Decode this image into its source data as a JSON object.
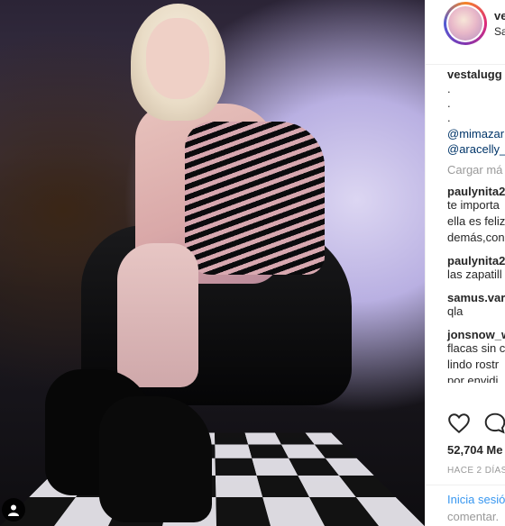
{
  "post": {
    "username": "vestalugg",
    "username_short": "ve",
    "location_short": "Sa"
  },
  "caption": {
    "username": "vestalugg",
    "lines": [
      ".",
      ".",
      "."
    ],
    "mentions": [
      "@mimazar",
      "@aracelly_"
    ]
  },
  "load_more": "Cargar má",
  "comments": [
    {
      "user": "paulynita2",
      "lines": [
        "te importa",
        "ella es feliz",
        "demás,con"
      ]
    },
    {
      "user": "paulynita2",
      "lines": [
        "las zapatill"
      ]
    },
    {
      "user": "samus.vara",
      "lines": [
        "qla"
      ]
    },
    {
      "user": "jonsnow_w",
      "lines": [
        "flacas sin c",
        "lindo rostr",
        "por envidi"
      ]
    }
  ],
  "likes": "52,704 Me",
  "date": "HACE 2 DÍAS",
  "login": {
    "link": "Inicia sesió",
    "rest": "comentar."
  },
  "icons": {
    "like": "heart-icon",
    "comment": "comment-icon",
    "tag": "user-tag-icon"
  }
}
